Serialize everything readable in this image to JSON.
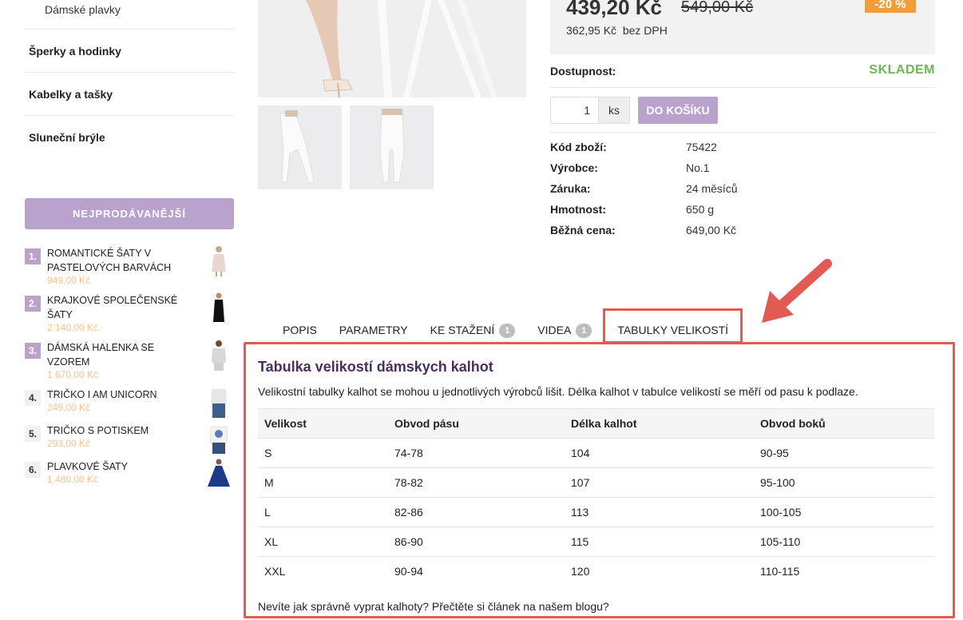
{
  "sidebar": {
    "sub_item": "Dámské plavky",
    "categories": [
      "Šperky a hodinky",
      "Kabelky a tašky",
      "Sluneční brýle"
    ],
    "bestsellers_label": "NEJPRODÁVANĚJŠÍ",
    "bestsellers": [
      {
        "rank": "1.",
        "name": "Romantické šaty v pastelových barvách",
        "price": "949,00 Kč"
      },
      {
        "rank": "2.",
        "name": "Krajkové společenské šaty",
        "price": "2 140,00 Kč"
      },
      {
        "rank": "3.",
        "name": "Dámská halenka se vzorem",
        "price": "1 670,00 Kč"
      },
      {
        "rank": "4.",
        "name": "Tričko I am unicorn",
        "price": "249,00 Kč"
      },
      {
        "rank": "5.",
        "name": "Tričko s potiskem",
        "price": "293,00 Kč"
      },
      {
        "rank": "6.",
        "name": "Plavkové šaty",
        "price": "1 480,00 Kč"
      }
    ]
  },
  "product": {
    "price": "439,20 Kč",
    "old_price": "549,00 Kč",
    "net_price": "362,95 Kč",
    "net_label": "bez DPH",
    "discount": "-20 %",
    "availability_label": "Dostupnost:",
    "availability_value": "SKLADEM",
    "quantity": "1",
    "unit": "ks",
    "cart_label": "DO KOŠÍKU",
    "specs": [
      {
        "key": "Kód zboží:",
        "value": "75422"
      },
      {
        "key": "Výrobce:",
        "value": "No.1"
      },
      {
        "key": "Záruka:",
        "value": "24 měsíců"
      },
      {
        "key": "Hmotnost:",
        "value": "650 g"
      },
      {
        "key": "Běžná cena:",
        "value": "649,00 Kč"
      }
    ]
  },
  "tabs": [
    {
      "label": "Popis",
      "badge": ""
    },
    {
      "label": "Parametry",
      "badge": ""
    },
    {
      "label": "Ke stažení",
      "badge": "1"
    },
    {
      "label": "Videa",
      "badge": "1"
    },
    {
      "label": "Tabulky velikostí",
      "badge": ""
    }
  ],
  "size_panel": {
    "title": "Tabulka velikostí dámskych kalhot",
    "description": "Velikostní tabulky kalhot se mohou u jednotlivých výrobců lišit. Délka kalhot v tabulce velikostí se měří od pasu k podlaze.",
    "headers": [
      "Velikost",
      "Obvod pásu",
      "Délka kalhot",
      "Obvod boků"
    ],
    "rows": [
      [
        "S",
        "74-78",
        "104",
        "90-95"
      ],
      [
        "M",
        "78-82",
        "107",
        "95-100"
      ],
      [
        "L",
        "82-86",
        "113",
        "100-105"
      ],
      [
        "XL",
        "86-90",
        "115",
        "105-110"
      ],
      [
        "XXL",
        "90-94",
        "120",
        "110-115"
      ]
    ],
    "note": "Nevíte jak správně vyprat kalhoty? Přečtěte si článek na našem blogu?"
  },
  "colors": {
    "accent": "#b9a3cc",
    "highlight": "#e25a54",
    "stock": "#6db656",
    "discount": "#f39c3a"
  }
}
